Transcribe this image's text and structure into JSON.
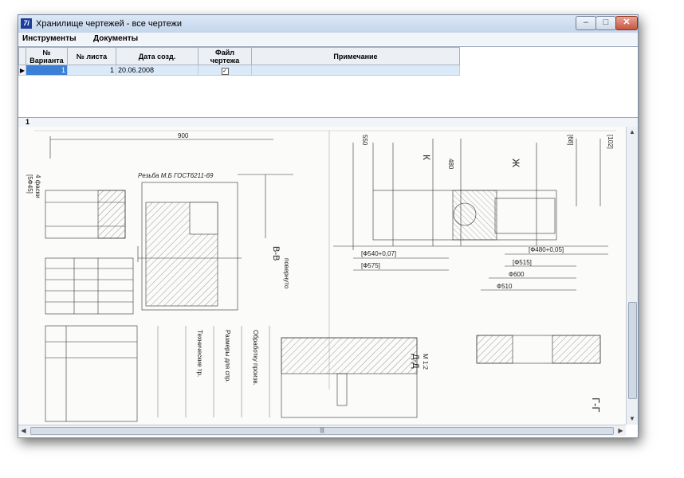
{
  "window": {
    "title": "Хранилище чертежей - все чертежи",
    "app_icon_text": "7i",
    "minimize_glyph": "–",
    "maximize_glyph": "□",
    "close_glyph": "✕"
  },
  "menu": {
    "tools": "Инструменты",
    "documents": "Документы"
  },
  "grid": {
    "headers": {
      "variant": "№ Варианта",
      "sheet": "№ листа",
      "date": "Дата созд.",
      "file": "Файл чертежа",
      "note": "Примечание"
    },
    "rows": [
      {
        "variant": "1",
        "sheet": "1",
        "date": "20.06.2008",
        "file_checked": true,
        "file_mark": "✓",
        "note": ""
      }
    ],
    "row_indicator": "▶"
  },
  "viewer": {
    "page_number": "1",
    "labels": {
      "top_dim": "900",
      "left_dim": "[5Ф45]",
      "left_sub": "4 фаски",
      "thread": "Резьба М.Б ГОСТ6211-69",
      "section_bb": "В-В",
      "section_bb_sub": "повернуто",
      "section_dd": "Д-Д",
      "section_dd_sub": "М 1:2",
      "section_gg": "Г-Г",
      "k_mark": "К",
      "zh_mark": "Ж",
      "d540": "[Ф540+0,07]",
      "d575": "[Ф575]",
      "d480": "[Ф480+0,05]",
      "d515": "[Ф515]",
      "d600": "Ф600",
      "d510": "Ф510",
      "dim_550": "550",
      "dim_480": "480",
      "dim_68": "[68]",
      "dim_102": "[102]",
      "notes_a": "Технические тр.",
      "notes_b": "Размеры для спр.",
      "notes_c": "Обработку произв."
    }
  },
  "scrollbars": {
    "up": "▲",
    "down": "▼",
    "left": "◀",
    "right": "▶",
    "grip": "|||"
  }
}
